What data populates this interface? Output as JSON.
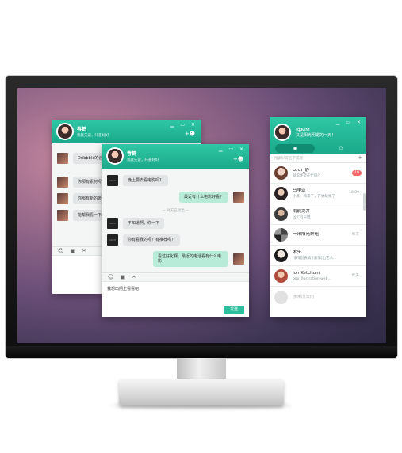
{
  "win_controls": "▁ ▭ ✕",
  "chat_back": {
    "contact_name": "春鹤",
    "contact_status": "我就先说，咔嘉好好",
    "messages": [
      {
        "side": "left",
        "text": "Dribbble的设计"
      },
      {
        "side": "left",
        "text": "你那有素材吗？"
      },
      {
        "side": "left",
        "text": "你那有新的邀请码么"
      },
      {
        "side": "left",
        "text": "能帮我看一下么？"
      }
    ]
  },
  "chat_front": {
    "contact_name": "春鹤",
    "contact_status": "我就先说，咔嘉好好",
    "messages": [
      {
        "side": "left",
        "text": "晚上要去看电影吗？"
      },
      {
        "side": "right",
        "text": "最近有什么电影好看？"
      },
      {
        "side": "left",
        "text": "不知道啊，你一下"
      },
      {
        "side": "left",
        "text": "你有看我的吗？有推荐吗？"
      },
      {
        "side": "right",
        "text": "看过好化啊，最近的电话看有什么电影"
      }
    ],
    "system_note": "— 对方已退出 —",
    "input_text": "我想出问上看看吧",
    "send_label": "发送"
  },
  "contacts": {
    "username": "韩MM",
    "signature": "又是阳光明媚的一天！",
    "search_placeholder": "搜索好友名字或者",
    "add_icon_label": "+",
    "items": [
      {
        "name": "Lucy_静",
        "sub": "就说还是在忙吗？",
        "time": "",
        "badge": "10"
      },
      {
        "name": "马里亚",
        "sub": "小黑：风来了，开始睡觉了",
        "time": "18:09",
        "badge": ""
      },
      {
        "name": "雨前龙井",
        "sub": "这个可以拍",
        "time": "",
        "badge": ""
      },
      {
        "name": "一米阳光群组",
        "sub": "",
        "time": "昨天",
        "badge": ""
      },
      {
        "name": "木头",
        "sub": "[表情][表情][表情]出艺术...",
        "time": "",
        "badge": ""
      },
      {
        "name": "Jon Ketchum",
        "sub": "ogo illustration web...",
        "time": "昨天",
        "badge": ""
      },
      {
        "name": "涉来而去的",
        "sub": "",
        "time": "",
        "badge": ""
      }
    ]
  }
}
